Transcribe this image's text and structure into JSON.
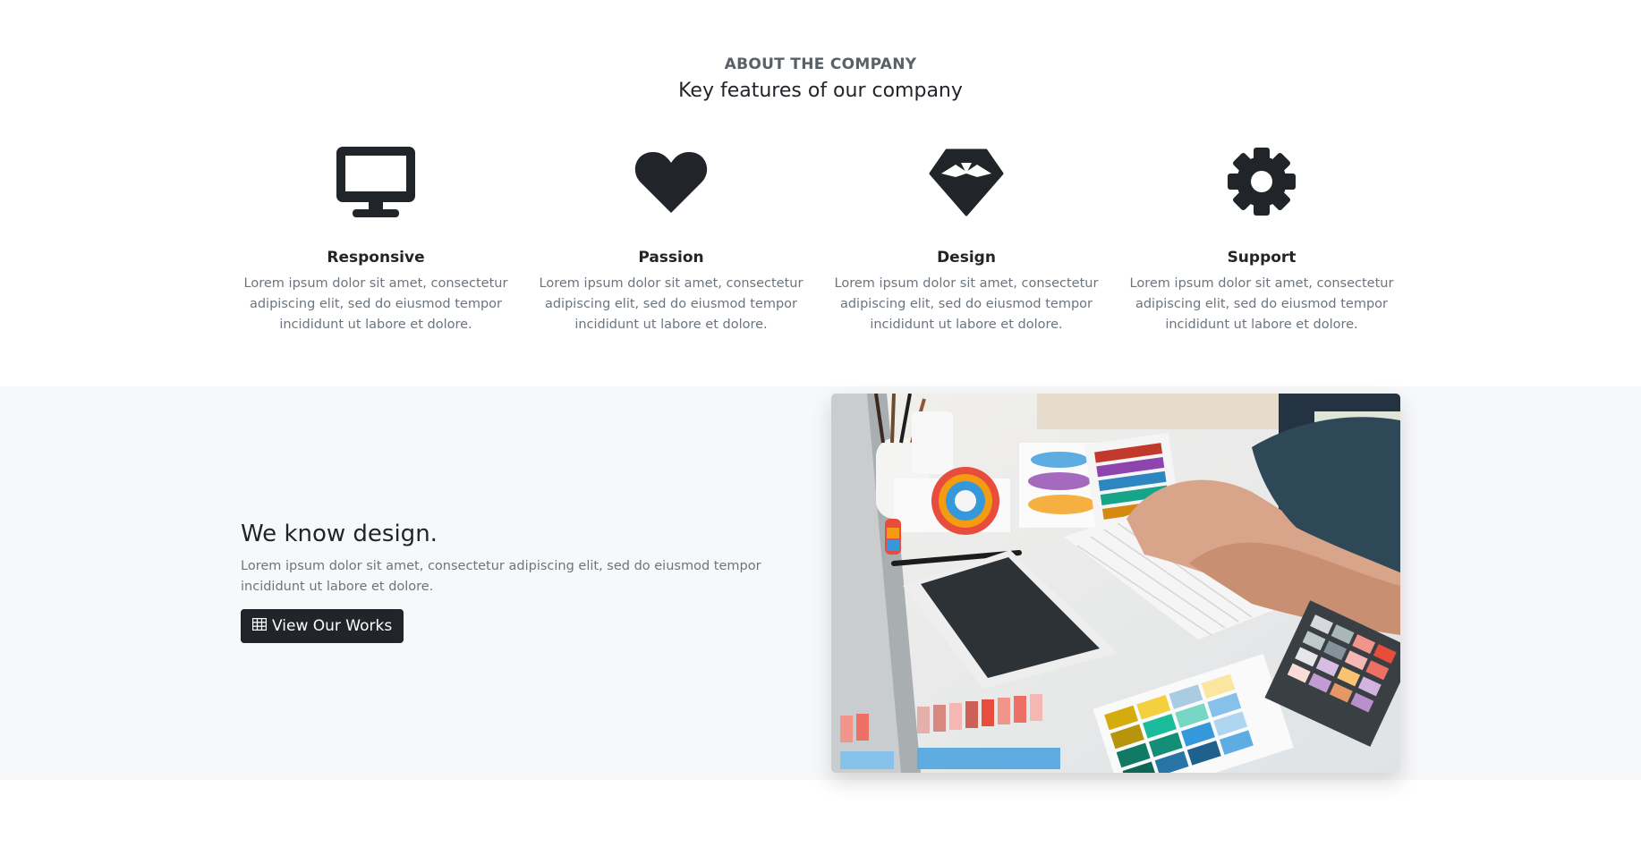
{
  "about": {
    "eyebrow": "ABOUT THE COMPANY",
    "subtitle": "Key features of our company"
  },
  "features": [
    {
      "title": "Responsive",
      "icon": "desktop-icon",
      "description": "Lorem ipsum dolor sit amet, consectetur adipiscing elit, sed do eiusmod tempor incididunt ut labore et dolore."
    },
    {
      "title": "Passion",
      "icon": "heart-icon",
      "description": "Lorem ipsum dolor sit amet, consectetur adipiscing elit, sed do eiusmod tempor incididunt ut labore et dolore."
    },
    {
      "title": "Design",
      "icon": "diamond-icon",
      "description": "Lorem ipsum dolor sit amet, consectetur adipiscing elit, sed do eiusmod tempor incididunt ut labore et dolore."
    },
    {
      "title": "Support",
      "icon": "gear-icon",
      "description": "Lorem ipsum dolor sit amet, consectetur adipiscing elit, sed do eiusmod tempor incididunt ut labore et dolore."
    }
  ],
  "design_section": {
    "heading": "We know design.",
    "body": "Lorem ipsum dolor sit amet, consectetur adipiscing elit, sed do eiusmod tempor incididunt ut labore et dolore.",
    "button_label": "View Our Works",
    "button_icon": "table-grid-icon",
    "photo": "designer-desk-photo"
  },
  "colors": {
    "dark": "#212529",
    "muted": "#6c757d",
    "section_bg": "#f7f8fa"
  }
}
